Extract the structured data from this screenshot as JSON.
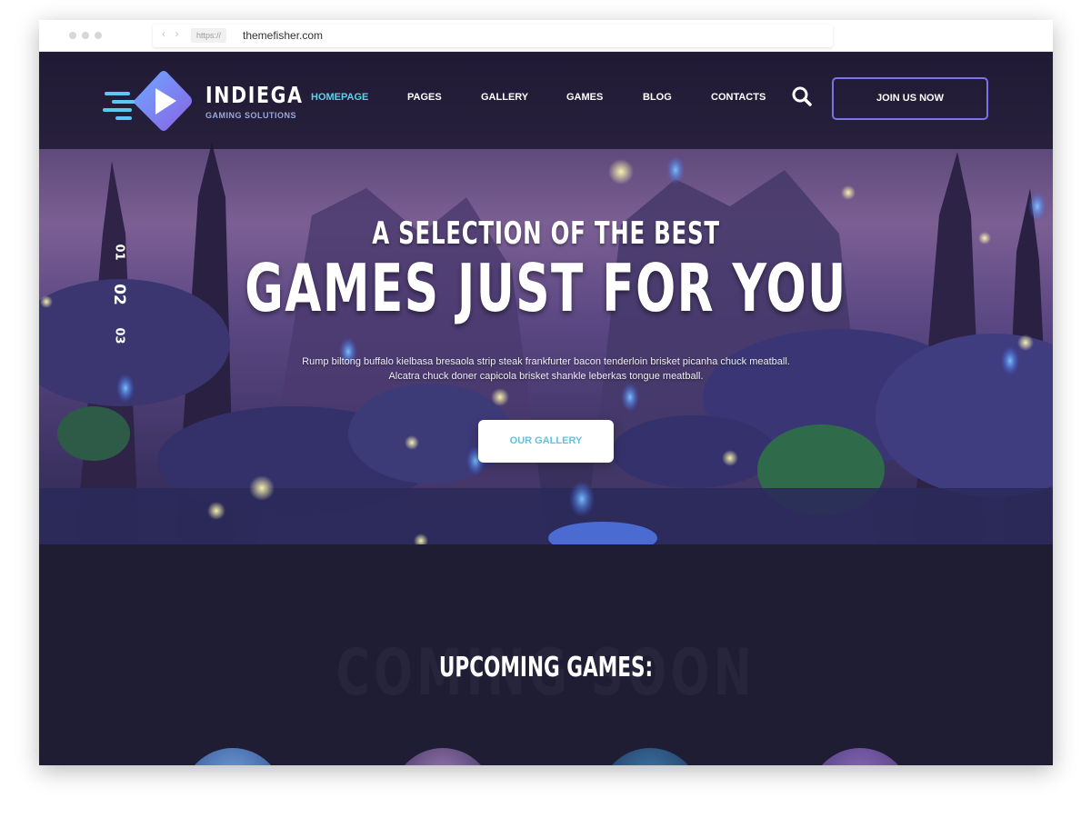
{
  "browser": {
    "protocol": "https://",
    "host": "themefisher.com",
    "nav_arrows": "‹ ›"
  },
  "site": {
    "brand": "INDIEGA",
    "tagline": "GAMING SOLUTIONS",
    "logo_icon": "play-icon"
  },
  "nav": {
    "items": [
      {
        "label": "HOMEPAGE",
        "active": true
      },
      {
        "label": "PAGES",
        "active": false
      },
      {
        "label": "GALLERY",
        "active": false
      },
      {
        "label": "GAMES",
        "active": false
      },
      {
        "label": "BLOG",
        "active": false
      },
      {
        "label": "CONTACTS",
        "active": false
      }
    ],
    "search_icon": "search-icon",
    "join_label": "JOIN US NOW"
  },
  "hero": {
    "subtitle": "A SELECTION OF THE BEST",
    "title": "GAMES JUST FOR YOU",
    "description_line1": "Rump biltong buffalo kielbasa bresaola strip steak frankfurter bacon tenderloin brisket picanha chuck meatball.",
    "description_line2": "Alcatra chuck doner capicola brisket shankle leberkas tongue meatball.",
    "button_label": "OUR GALLERY",
    "slides": [
      {
        "label": "01",
        "active": false
      },
      {
        "label": "02",
        "active": true
      },
      {
        "label": "03",
        "active": false
      }
    ]
  },
  "upcoming": {
    "ghost_text": "COMING SOON",
    "title": "UPCOMING GAMES:"
  },
  "colors": {
    "accent_cyan": "#5fd0e6",
    "accent_purple": "#7c74e6",
    "page_dark": "#1f1d33"
  }
}
